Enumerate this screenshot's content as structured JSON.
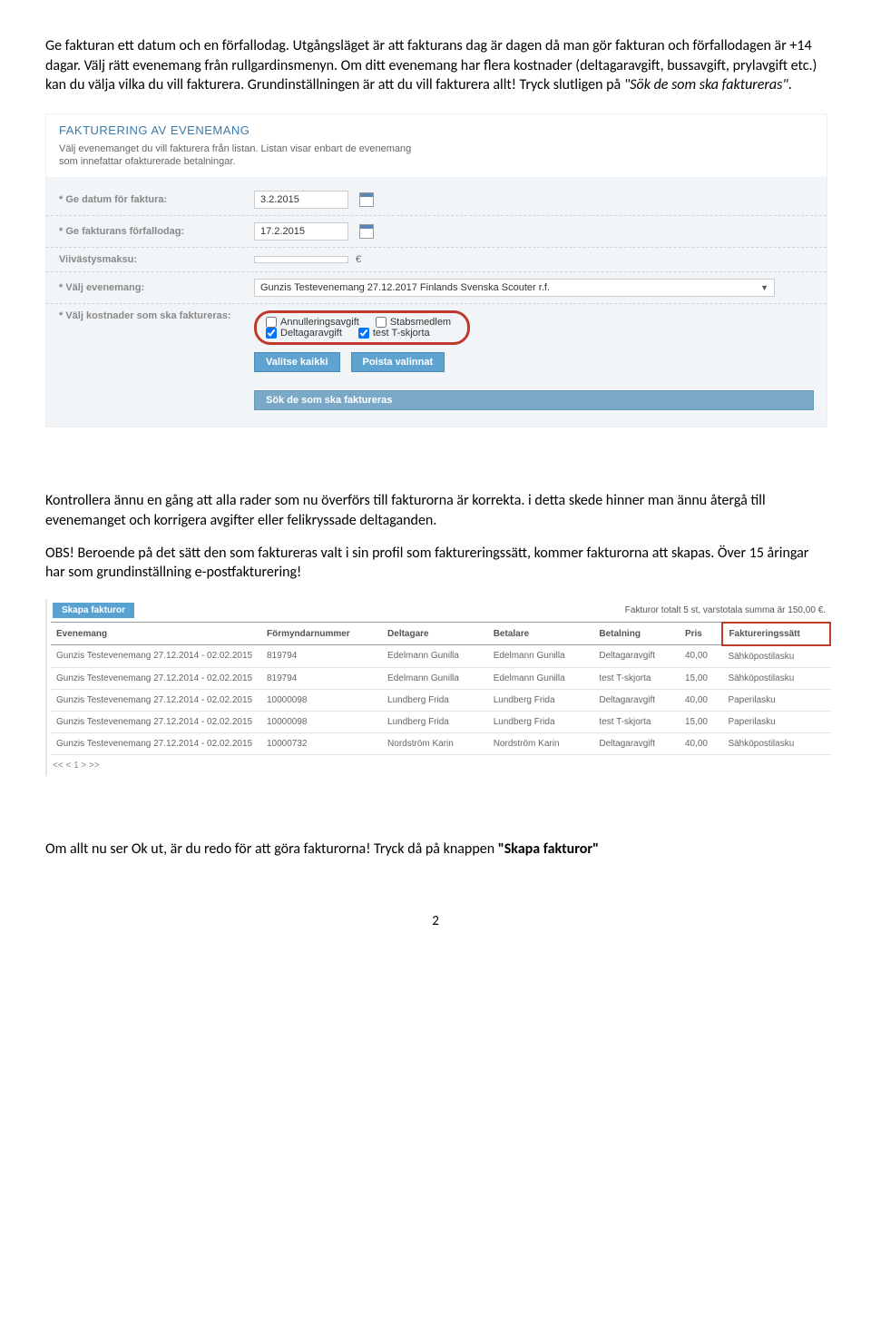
{
  "para1_a": "Ge fakturan ett datum och en förfallodag. Utgångsläget är att fakturans dag är dagen då man gör fakturan och förfallodagen är +14 dagar. Välj rätt evenemang från rullgardinsmenyn. Om ditt evenemang har flera kostnader (deltagaravgift, bussavgift, prylavgift etc.) kan du välja vilka du vill fakturera. Grundinställningen är att du vill fakturera allt! Tryck slutligen på ",
  "para1_italic": "\"Sök de som ska faktureras\"",
  "para1_b": ".",
  "s1": {
    "header": "FAKTURERING AV EVENEMANG",
    "intro1": "Välj evenemanget du vill fakturera från listan. Listan visar enbart de evenemang",
    "intro2": "som innefattar ofakturerade betalningar.",
    "row1_label": "* Ge datum för faktura:",
    "row1_value": "3.2.2015",
    "row2_label": "* Ge fakturans förfallodag:",
    "row2_value": "17.2.2015",
    "row3_label": "Viivästysmaksu:",
    "row3_value": "",
    "eur": "€",
    "row4_label": "* Välj evenemang:",
    "row4_value": "Gunzis Testevenemang 27.12.2017 Finlands Svenska Scouter r.f.",
    "row5_label": "* Välj kostnader som ska faktureras:",
    "cost1": "Annulleringsavgift",
    "cost2": "Stabsmedlem",
    "cost3": "Deltagaravgift",
    "cost4": "test T-skjorta",
    "btn_all": "Valitse kaikki",
    "btn_none": "Poista valinnat",
    "btn_search": "Sök de som ska faktureras"
  },
  "para2": "Kontrollera ännu en gång att alla rader som nu överförs till fakturorna är korrekta. i detta skede hinner man ännu återgå till evenemanget och korrigera avgifter eller felikryssade deltaganden.",
  "para3_a": "OBS! Beroende på det sätt den som faktureras valt i sin profil som faktureringssätt, kommer fakturorna att skapas. ",
  "para3_b": "Över 15 åringar har som grundinställning e-postfakturering!",
  "s2": {
    "chip": "Skapa fakturor",
    "total": "Fakturor totalt 5 st, varstotala summa är 150,00 €.",
    "headers": [
      "Evenemang",
      "Förmyndarnummer",
      "Deltagare",
      "Betalare",
      "Betalning",
      "Pris",
      "Faktureringssätt"
    ],
    "rows": [
      {
        "ev": "Gunzis Testevenemang 27.12.2014 - 02.02.2015",
        "fn": "819794",
        "d": "Edelmann Gunilla",
        "b": "Edelmann Gunilla",
        "bet": "Deltagaravgift",
        "p": "40,00",
        "f": "Sähköpostilasku"
      },
      {
        "ev": "Gunzis Testevenemang 27.12.2014 - 02.02.2015",
        "fn": "819794",
        "d": "Edelmann Gunilla",
        "b": "Edelmann Gunilla",
        "bet": "test T-skjorta",
        "p": "15,00",
        "f": "Sähköpostilasku"
      },
      {
        "ev": "Gunzis Testevenemang 27.12.2014 - 02.02.2015",
        "fn": "10000098",
        "d": "Lundberg Frida",
        "b": "Lundberg Frida",
        "bet": "Deltagaravgift",
        "p": "40,00",
        "f": "Paperilasku"
      },
      {
        "ev": "Gunzis Testevenemang 27.12.2014 - 02.02.2015",
        "fn": "10000098",
        "d": "Lundberg Frida",
        "b": "Lundberg Frida",
        "bet": "test T-skjorta",
        "p": "15,00",
        "f": "Paperilasku"
      },
      {
        "ev": "Gunzis Testevenemang 27.12.2014 - 02.02.2015",
        "fn": "10000732",
        "d": "Nordström Karin",
        "b": "Nordström Karin",
        "bet": "Deltagaravgift",
        "p": "40,00",
        "f": "Sähköpostilasku"
      }
    ],
    "pager": "<< < 1 > >>"
  },
  "para4_a": "Om allt nu ser Ok ut, är du redo för att göra fakturorna! Tryck då på knappen ",
  "para4_b": "\"Skapa fakturor\"",
  "page_num": "2"
}
